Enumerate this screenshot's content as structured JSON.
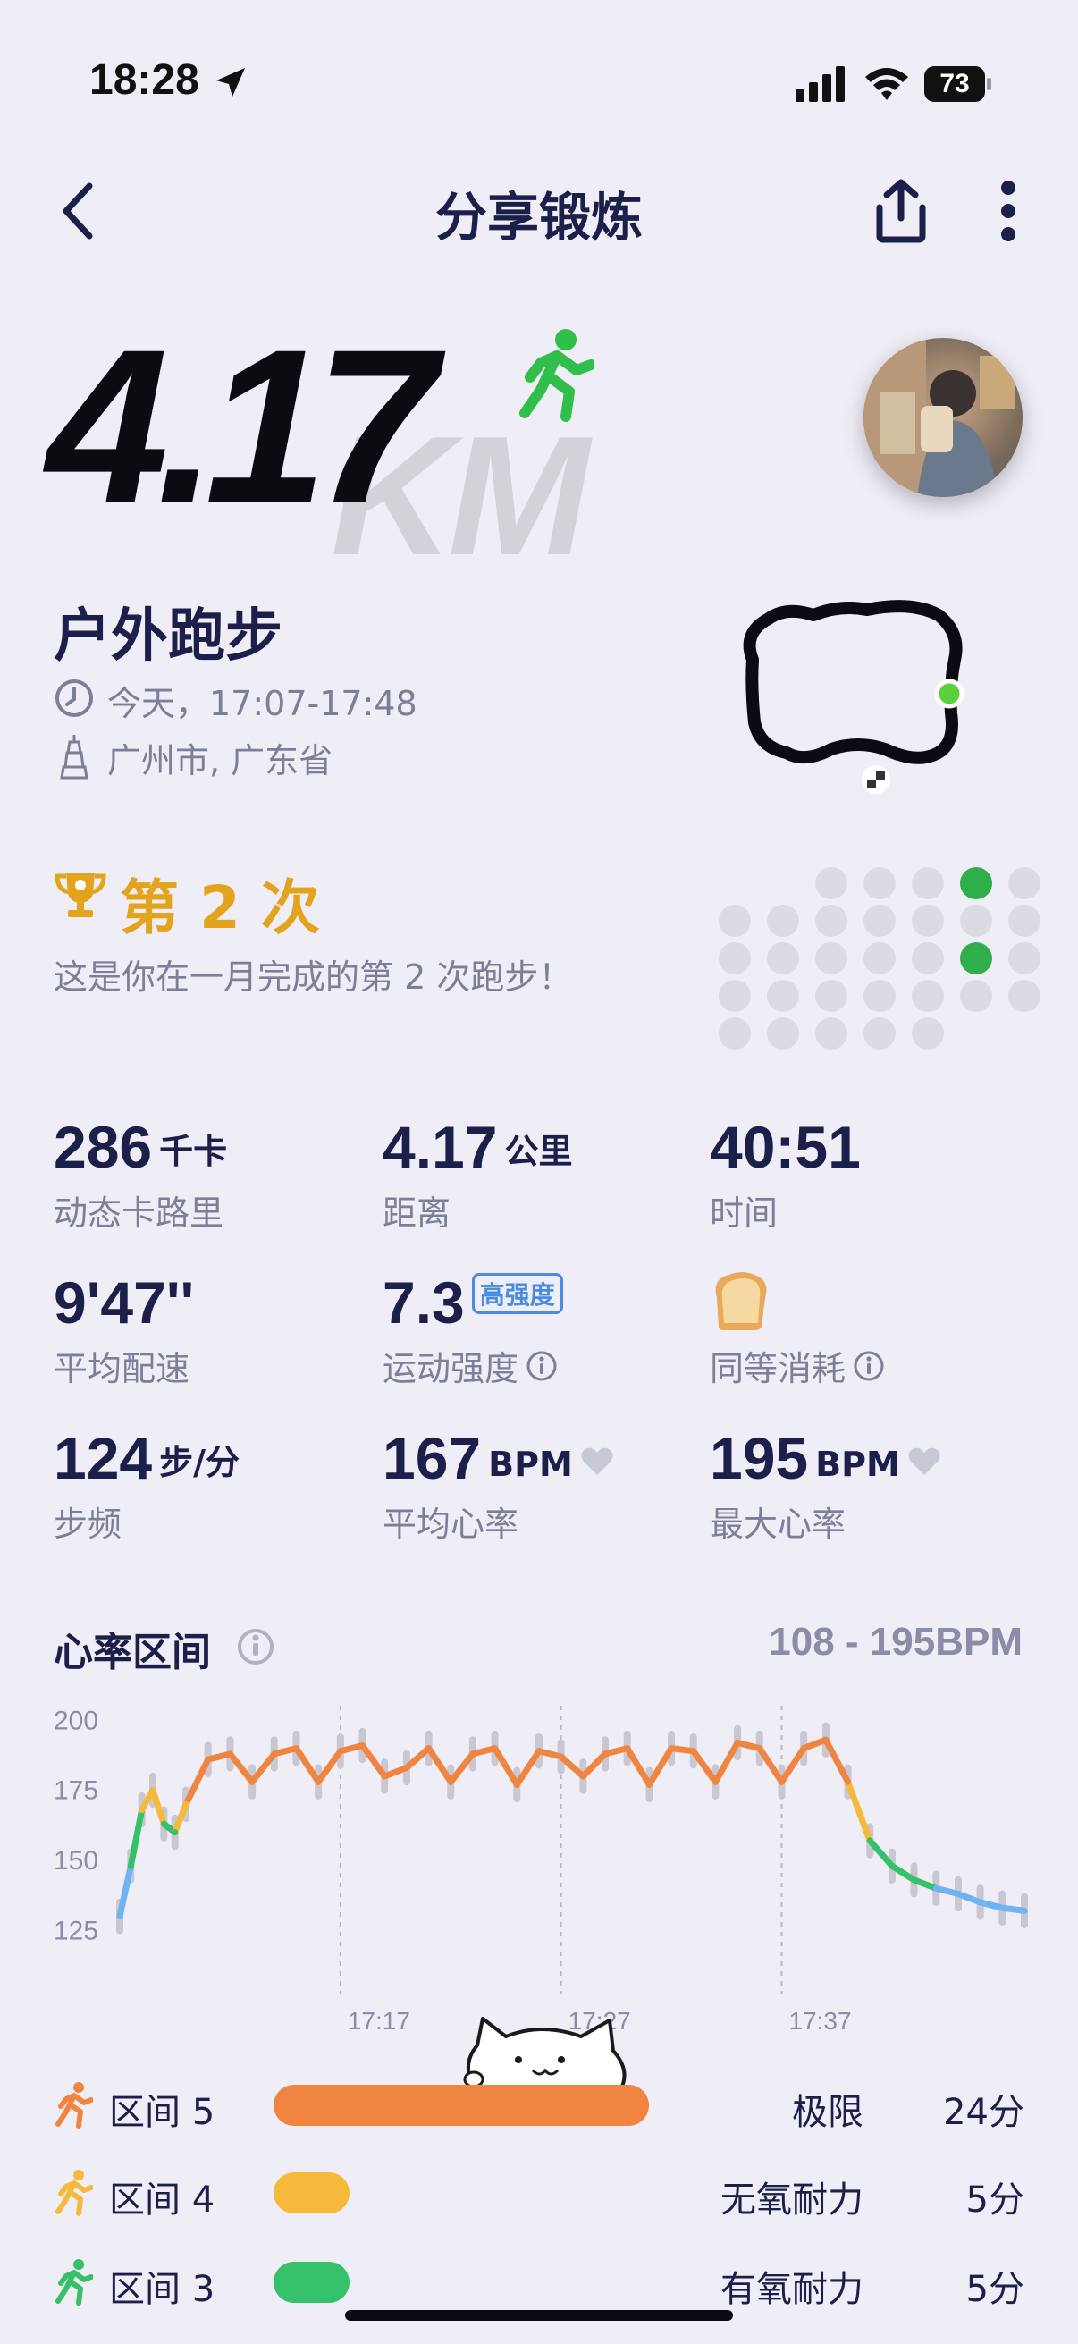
{
  "status": {
    "time": "18:28",
    "battery": "73"
  },
  "nav": {
    "title": "分享锻炼"
  },
  "hero": {
    "distance": "4.17",
    "unit": "KM"
  },
  "activity": {
    "title": "户外跑步",
    "time_range": "今天，17:07-17:48",
    "location": "广州市, 广东省"
  },
  "achievement": {
    "title": "第 2 次",
    "subtitle": "这是你在一月完成的第 2 次跑步！"
  },
  "stats": [
    {
      "value": "286",
      "unit": "千卡",
      "label": "动态卡路里"
    },
    {
      "value": "4.17",
      "unit": "公里",
      "label": "距离"
    },
    {
      "value": "40:51",
      "unit": "",
      "label": "时间"
    },
    {
      "value": "9'47''",
      "unit": "",
      "label": "平均配速"
    },
    {
      "value": "7.3",
      "badge": "高强度",
      "label": "运动强度"
    },
    {
      "value": "",
      "label": "同等消耗",
      "icon": "bread-icon"
    },
    {
      "value": "124",
      "unit": "步/分",
      "label": "步频"
    },
    {
      "value": "167",
      "unit": "BPM",
      "label": "平均心率"
    },
    {
      "value": "195",
      "unit": "BPM",
      "label": "最大心率"
    }
  ],
  "hr": {
    "title": "心率区间",
    "range": "108 - 195BPM"
  },
  "chart_data": {
    "type": "line",
    "title": "",
    "xlabel": "",
    "ylabel": "",
    "x_ticks": [
      "17:17",
      "17:27",
      "17:37"
    ],
    "y_ticks": [
      200,
      175,
      150,
      125
    ],
    "ylim": [
      112,
      202
    ],
    "x_minutes": [
      0,
      0.5,
      1,
      1.5,
      2,
      2.5,
      3,
      4,
      5,
      6,
      7,
      8,
      9,
      10,
      11,
      12,
      13,
      14,
      15,
      16,
      17,
      18,
      19,
      20,
      21,
      22,
      23,
      24,
      25,
      26,
      27,
      28,
      29,
      30,
      31,
      32,
      33,
      34,
      35,
      36,
      37,
      38,
      39,
      40,
      41
    ],
    "values": [
      130,
      148,
      168,
      175,
      163,
      160,
      170,
      186,
      188,
      178,
      188,
      190,
      178,
      189,
      191,
      180,
      183,
      190,
      178,
      188,
      190,
      177,
      189,
      187,
      180,
      188,
      190,
      177,
      190,
      189,
      178,
      192,
      190,
      178,
      190,
      193,
      178,
      157,
      148,
      143,
      140,
      138,
      135,
      133,
      132
    ],
    "grid": "vertical dashed at x ticks",
    "legend": "none",
    "colors": {
      "zone5": "#f08542",
      "zone4": "#f6b93b",
      "zone3": "#35c06a",
      "zone2": "#6fb4f2"
    }
  },
  "zones": [
    {
      "label": "区间 5",
      "name": "极限",
      "minutes": "24分",
      "color": "#f08542",
      "fraction": 0.59
    },
    {
      "label": "区间 4",
      "name": "无氧耐力",
      "minutes": "5分",
      "color": "#f6b93b",
      "fraction": 0.12
    },
    {
      "label": "区间 3",
      "name": "有氧耐力",
      "minutes": "5分",
      "color": "#35c06a",
      "fraction": 0.12
    }
  ]
}
